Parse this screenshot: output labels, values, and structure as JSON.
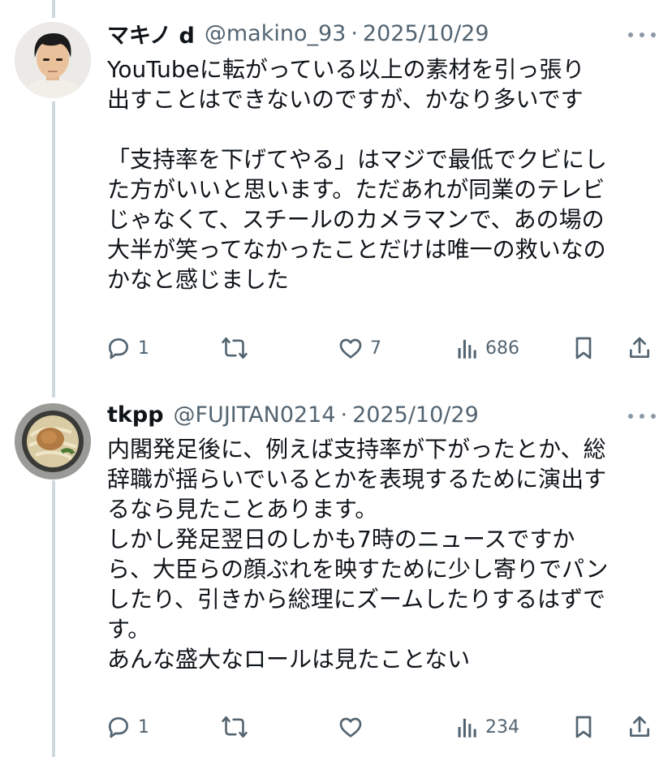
{
  "posts": [
    {
      "name": "マキノ d",
      "handle": "@makino_93",
      "separator": "·",
      "date": "2025/10/29",
      "text": "YouTubeに転がっている以上の素材を引っ張り\n出すことはできないのですが、かなり多いです\n\n「支持率を下げてやる」はマジで最低でクビにし\nた方がいいと思います。ただあれが同業のテレビ\nじゃなくて、スチールのカメラマンで、あの場の\n大半が笑ってなかったことだけは唯一の救いなの\nかなと感じました",
      "replies": "1",
      "reposts": "",
      "likes": "7",
      "views": "686",
      "avatar_icon": "person-avatar"
    },
    {
      "name": "tkpp",
      "handle": "@FUJITAN0214",
      "separator": "·",
      "date": "2025/10/29",
      "text": "内閣発足後に、例えば支持率が下がったとか、総\n辞職が揺らいでいるとかを表現するために演出す\nるなら見たことあります。\nしかし発足翌日のしかも7時のニュースですか\nら、大臣らの顔ぶれを映すために少し寄りでパン\nしたり、引きから総理にズームしたりするはずで\nす。\nあんな盛大なロールは見たことない",
      "replies": "1",
      "reposts": "",
      "likes": "",
      "views": "234",
      "avatar_icon": "udon-bowl-avatar"
    }
  ],
  "icons": {
    "reply": "reply-icon",
    "repost": "repost-icon",
    "like": "like-icon",
    "views": "views-icon",
    "bookmark": "bookmark-icon",
    "share": "share-icon",
    "more": "more-icon"
  },
  "colors": {
    "text": "#0f1419",
    "secondary": "#536471",
    "thread_line": "#cfd9de"
  }
}
